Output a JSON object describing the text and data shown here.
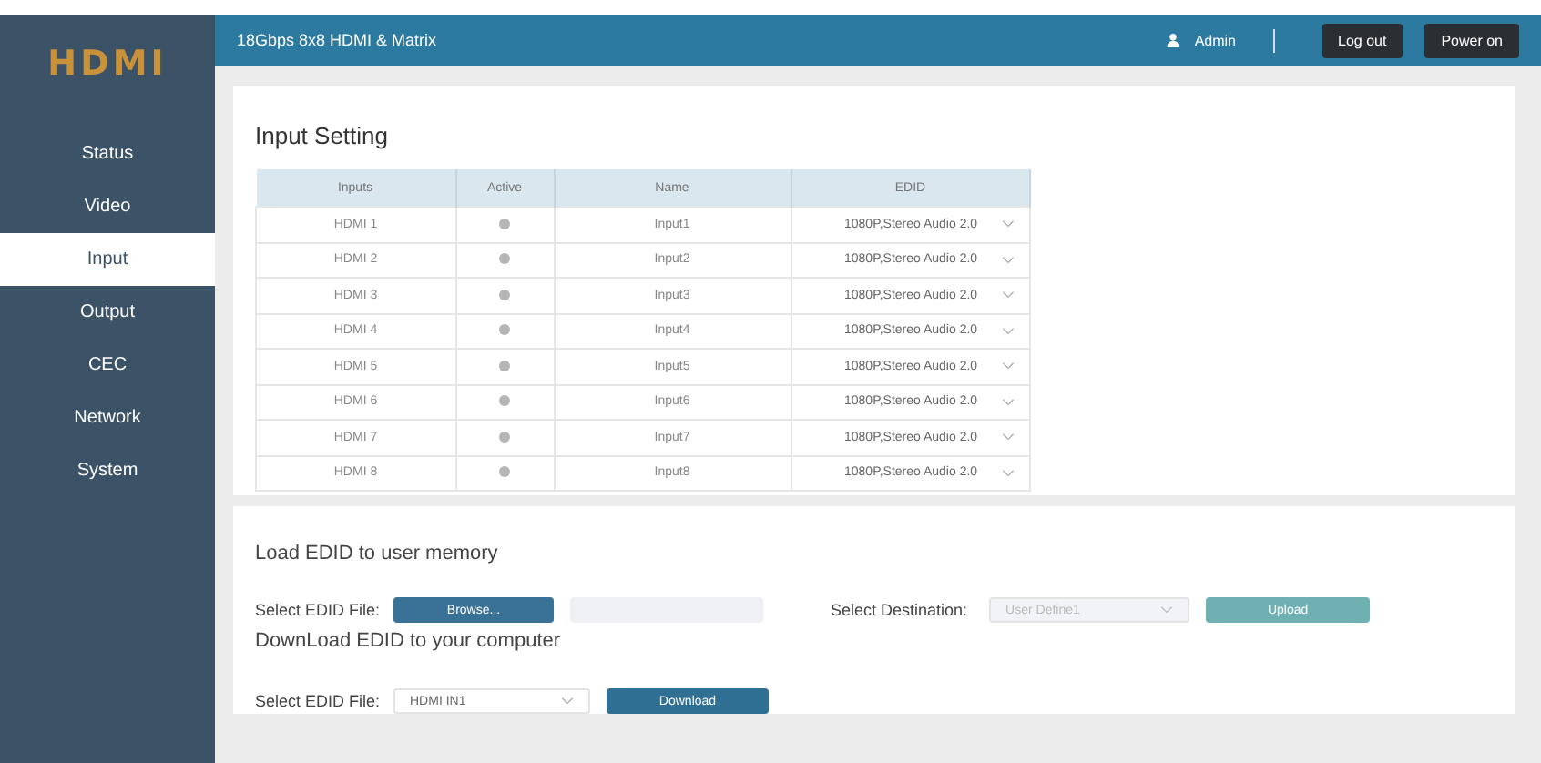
{
  "logo": {
    "text": "HDMI"
  },
  "header": {
    "title": "18Gbps 8x8 HDMI & Matrix",
    "user": "Admin",
    "buttons": [
      "Log out",
      "Power on"
    ]
  },
  "sidebar": {
    "items": [
      {
        "label": "Status",
        "selected": false
      },
      {
        "label": "Video",
        "selected": false
      },
      {
        "label": "Input",
        "selected": true
      },
      {
        "label": "Output",
        "selected": false
      },
      {
        "label": "CEC",
        "selected": false
      },
      {
        "label": "Network",
        "selected": false
      },
      {
        "label": "System",
        "selected": false
      }
    ]
  },
  "input_setting": {
    "title": "Input Setting",
    "columns": [
      "Inputs",
      "Active",
      "Name",
      "EDID"
    ],
    "rows": [
      {
        "input": "HDMI 1",
        "active": false,
        "name": "Input1",
        "edid": "1080P,Stereo Audio 2.0"
      },
      {
        "input": "HDMI 2",
        "active": false,
        "name": "Input2",
        "edid": "1080P,Stereo Audio 2.0"
      },
      {
        "input": "HDMI 3",
        "active": false,
        "name": "Input3",
        "edid": "1080P,Stereo Audio 2.0"
      },
      {
        "input": "HDMI 4",
        "active": false,
        "name": "Input4",
        "edid": "1080P,Stereo Audio 2.0"
      },
      {
        "input": "HDMI 5",
        "active": false,
        "name": "Input5",
        "edid": "1080P,Stereo Audio 2.0"
      },
      {
        "input": "HDMI 6",
        "active": false,
        "name": "Input6",
        "edid": "1080P,Stereo Audio 2.0"
      },
      {
        "input": "HDMI 7",
        "active": false,
        "name": "Input7",
        "edid": "1080P,Stereo Audio 2.0"
      },
      {
        "input": "HDMI 8",
        "active": false,
        "name": "Input8",
        "edid": "1080P,Stereo Audio 2.0"
      }
    ]
  },
  "load_edid": {
    "title": "Load EDID to user memory",
    "file_label": "Select EDID File:",
    "browse_button": "Browse...",
    "destination_label": "Select Destination:",
    "destination": "User Define1",
    "upload_button": "Upload"
  },
  "download_edid": {
    "title": "DownLoad EDID to your computer",
    "file_label": "Select EDID File:",
    "file": "HDMI IN1",
    "download_button": "Download"
  }
}
